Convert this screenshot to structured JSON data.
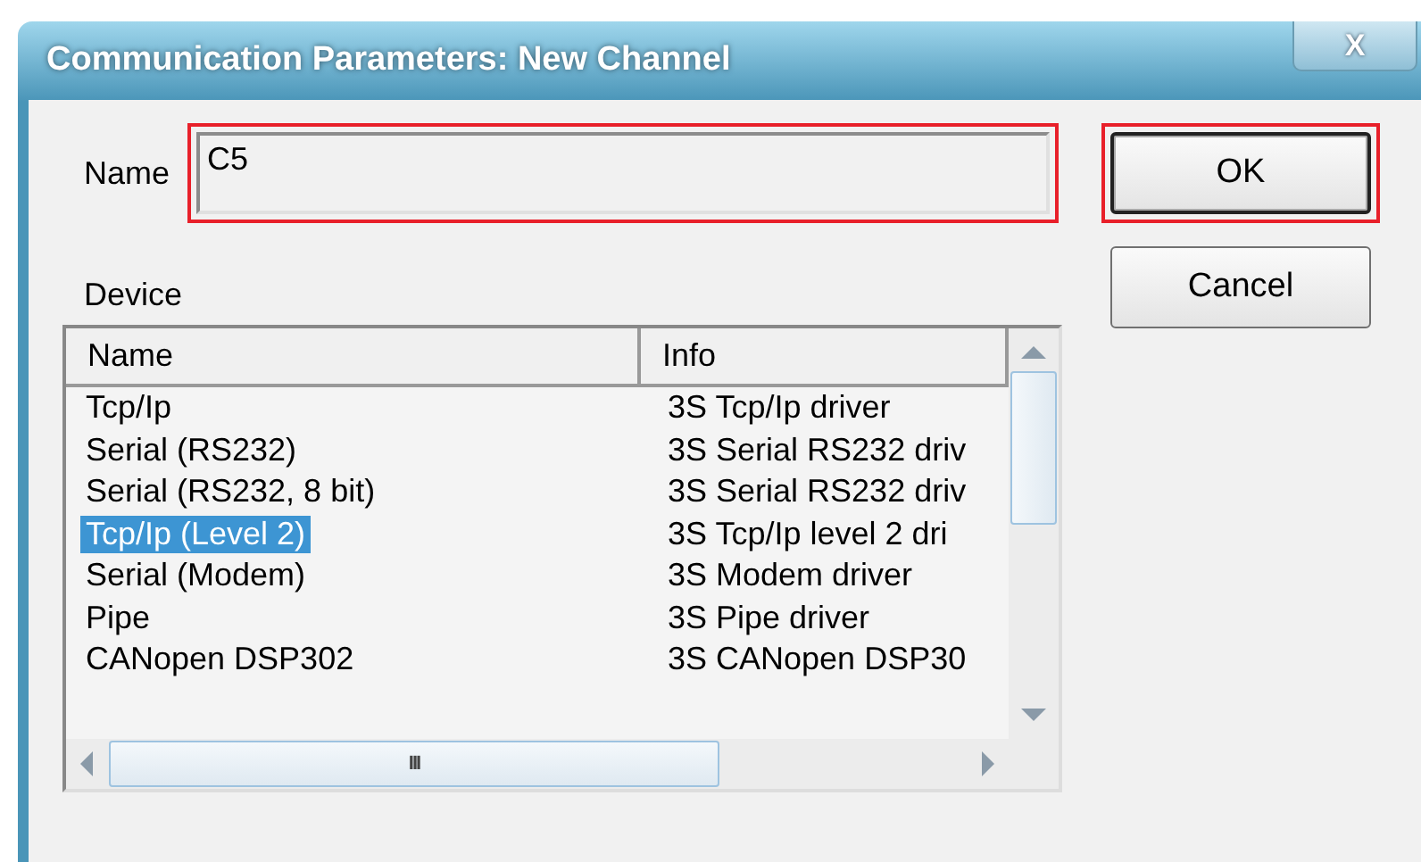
{
  "window": {
    "title": "Communication Parameters: New Channel",
    "close": "X"
  },
  "name_field": {
    "label": "Name",
    "value": "C5",
    "highlighted": true
  },
  "buttons": [
    {
      "label": "OK",
      "default": true,
      "highlighted": true
    },
    {
      "label": "Cancel",
      "default": false,
      "highlighted": false
    }
  ],
  "device": {
    "label": "Device",
    "columns": [
      "Name",
      "Info"
    ],
    "rows": [
      {
        "name": "Tcp/Ip",
        "info": "3S Tcp/Ip driver",
        "selected": false
      },
      {
        "name": "Serial (RS232)",
        "info": "3S Serial RS232 driv",
        "selected": false
      },
      {
        "name": "Serial (RS232, 8 bit)",
        "info": "3S Serial RS232 driv",
        "selected": false
      },
      {
        "name": "Tcp/Ip (Level 2)",
        "info": "3S Tcp/Ip level 2 dri",
        "selected": true
      },
      {
        "name": "Serial (Modem)",
        "info": "3S Modem driver",
        "selected": false
      },
      {
        "name": "Pipe",
        "info": "3S Pipe driver",
        "selected": false
      },
      {
        "name": "CANopen DSP302",
        "info": "3S CANopen DSP30",
        "selected": false
      }
    ],
    "hscroll_grip": "III"
  }
}
